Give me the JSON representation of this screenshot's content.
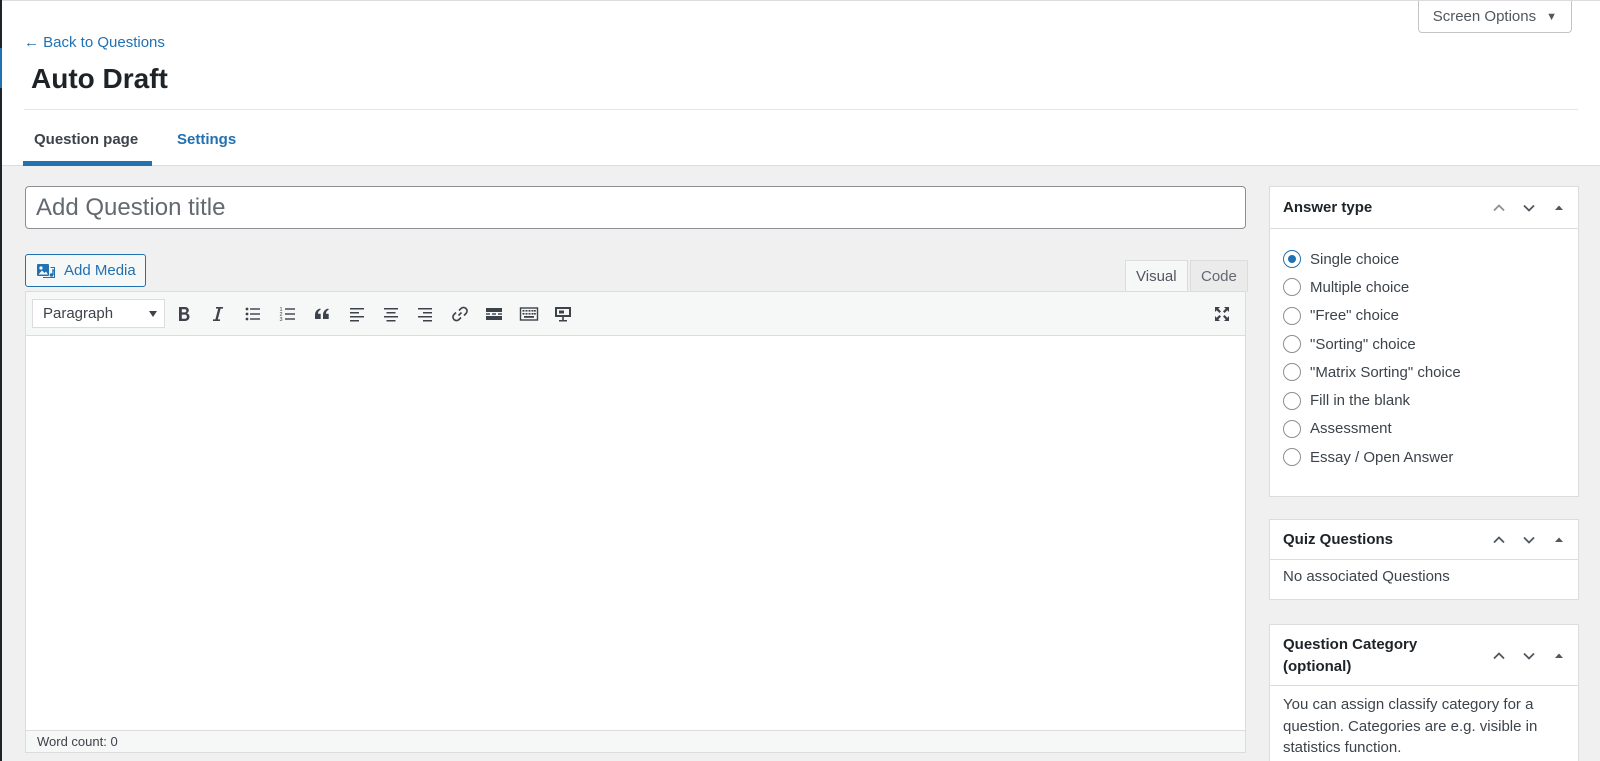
{
  "header": {
    "screen_options": "Screen Options",
    "back_link": "← Back to Questions",
    "page_title": "Auto Draft",
    "tabs": [
      {
        "label": "Question page",
        "active": true
      },
      {
        "label": "Settings",
        "active": false
      }
    ]
  },
  "editor": {
    "title_placeholder": "Add Question title",
    "add_media_label": "Add Media",
    "mode_tabs": {
      "visual": "Visual",
      "code": "Code"
    },
    "format_select_value": "Paragraph",
    "toolbar_icons": [
      "bold-icon",
      "italic-icon",
      "bulleted-list-icon",
      "numbered-list-icon",
      "blockquote-icon",
      "align-left-icon",
      "align-center-icon",
      "align-right-icon",
      "link-icon",
      "read-more-icon",
      "toolbar-toggle-icon",
      "presentation-icon",
      "fullscreen-icon"
    ],
    "word_count": "Word count: 0"
  },
  "sidebar": {
    "answer_type": {
      "title": "Answer type",
      "options": [
        {
          "label": "Single choice",
          "checked": true
        },
        {
          "label": "Multiple choice",
          "checked": false
        },
        {
          "label": "\"Free\" choice",
          "checked": false
        },
        {
          "label": "\"Sorting\" choice",
          "checked": false
        },
        {
          "label": "\"Matrix Sorting\" choice",
          "checked": false
        },
        {
          "label": "Fill in the blank",
          "checked": false
        },
        {
          "label": "Assessment",
          "checked": false
        },
        {
          "label": "Essay / Open Answer",
          "checked": false
        }
      ]
    },
    "quiz_questions": {
      "title": "Quiz Questions",
      "body": "No associated Questions"
    },
    "question_category": {
      "title_line1": "Question Category",
      "title_line2": "(optional)",
      "body": "You can assign classify category for a question. Categories are e.g. visible in statistics function."
    }
  },
  "colors": {
    "accent": "#2271b1",
    "text": "#1d2327",
    "background": "#f0f0f1"
  }
}
